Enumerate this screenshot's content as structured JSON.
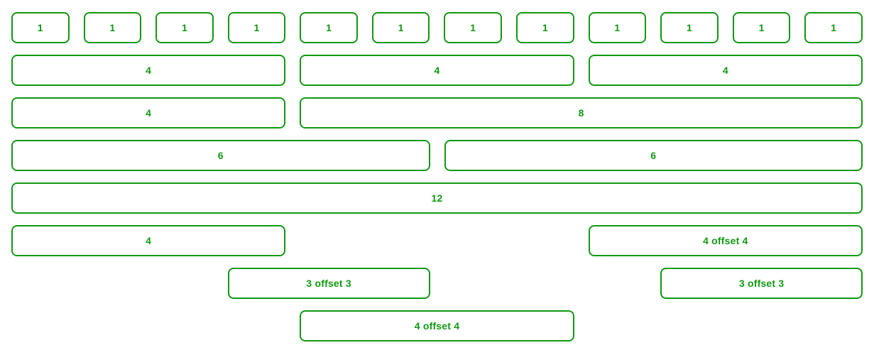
{
  "theme": {
    "accent_color": "#119911",
    "text_color": "#119911",
    "background_color": "#ffffff",
    "border_color": "#119911"
  },
  "layout": {
    "total_columns": 12,
    "rows": [
      {
        "name": "row-of-twelve-single-columns",
        "cells": [
          {
            "label": "1",
            "span": 1,
            "offset": 0
          },
          {
            "label": "1",
            "span": 1,
            "offset": 0
          },
          {
            "label": "1",
            "span": 1,
            "offset": 0
          },
          {
            "label": "1",
            "span": 1,
            "offset": 0
          },
          {
            "label": "1",
            "span": 1,
            "offset": 0
          },
          {
            "label": "1",
            "span": 1,
            "offset": 0
          },
          {
            "label": "1",
            "span": 1,
            "offset": 0
          },
          {
            "label": "1",
            "span": 1,
            "offset": 0
          },
          {
            "label": "1",
            "span": 1,
            "offset": 0
          },
          {
            "label": "1",
            "span": 1,
            "offset": 0
          },
          {
            "label": "1",
            "span": 1,
            "offset": 0
          },
          {
            "label": "1",
            "span": 1,
            "offset": 0
          }
        ]
      },
      {
        "name": "row-of-three-quarters",
        "cells": [
          {
            "label": "4",
            "span": 4,
            "offset": 0
          },
          {
            "label": "4",
            "span": 4,
            "offset": 0
          },
          {
            "label": "4",
            "span": 4,
            "offset": 0
          }
        ]
      },
      {
        "name": "row-four-and-eight",
        "cells": [
          {
            "label": "4",
            "span": 4,
            "offset": 0
          },
          {
            "label": "8",
            "span": 8,
            "offset": 0
          }
        ]
      },
      {
        "name": "row-of-two-halves",
        "cells": [
          {
            "label": "6",
            "span": 6,
            "offset": 0
          },
          {
            "label": "6",
            "span": 6,
            "offset": 0
          }
        ]
      },
      {
        "name": "row-full-width",
        "cells": [
          {
            "label": "12",
            "span": 12,
            "offset": 0
          }
        ]
      },
      {
        "name": "row-four-and-four-offset-four",
        "cells": [
          {
            "label": "4",
            "span": 4,
            "offset": 0
          },
          {
            "label": "4 offset 4",
            "span": 4,
            "offset": 4
          }
        ]
      },
      {
        "name": "row-three-offset-three-twice",
        "cells": [
          {
            "label": "3 offset 3",
            "span": 3,
            "offset": 3
          },
          {
            "label": "3 offset 3",
            "span": 3,
            "offset": 3
          }
        ]
      },
      {
        "name": "row-four-offset-four",
        "cells": [
          {
            "label": "4 offset 4",
            "span": 4,
            "offset": 4
          }
        ]
      }
    ]
  }
}
